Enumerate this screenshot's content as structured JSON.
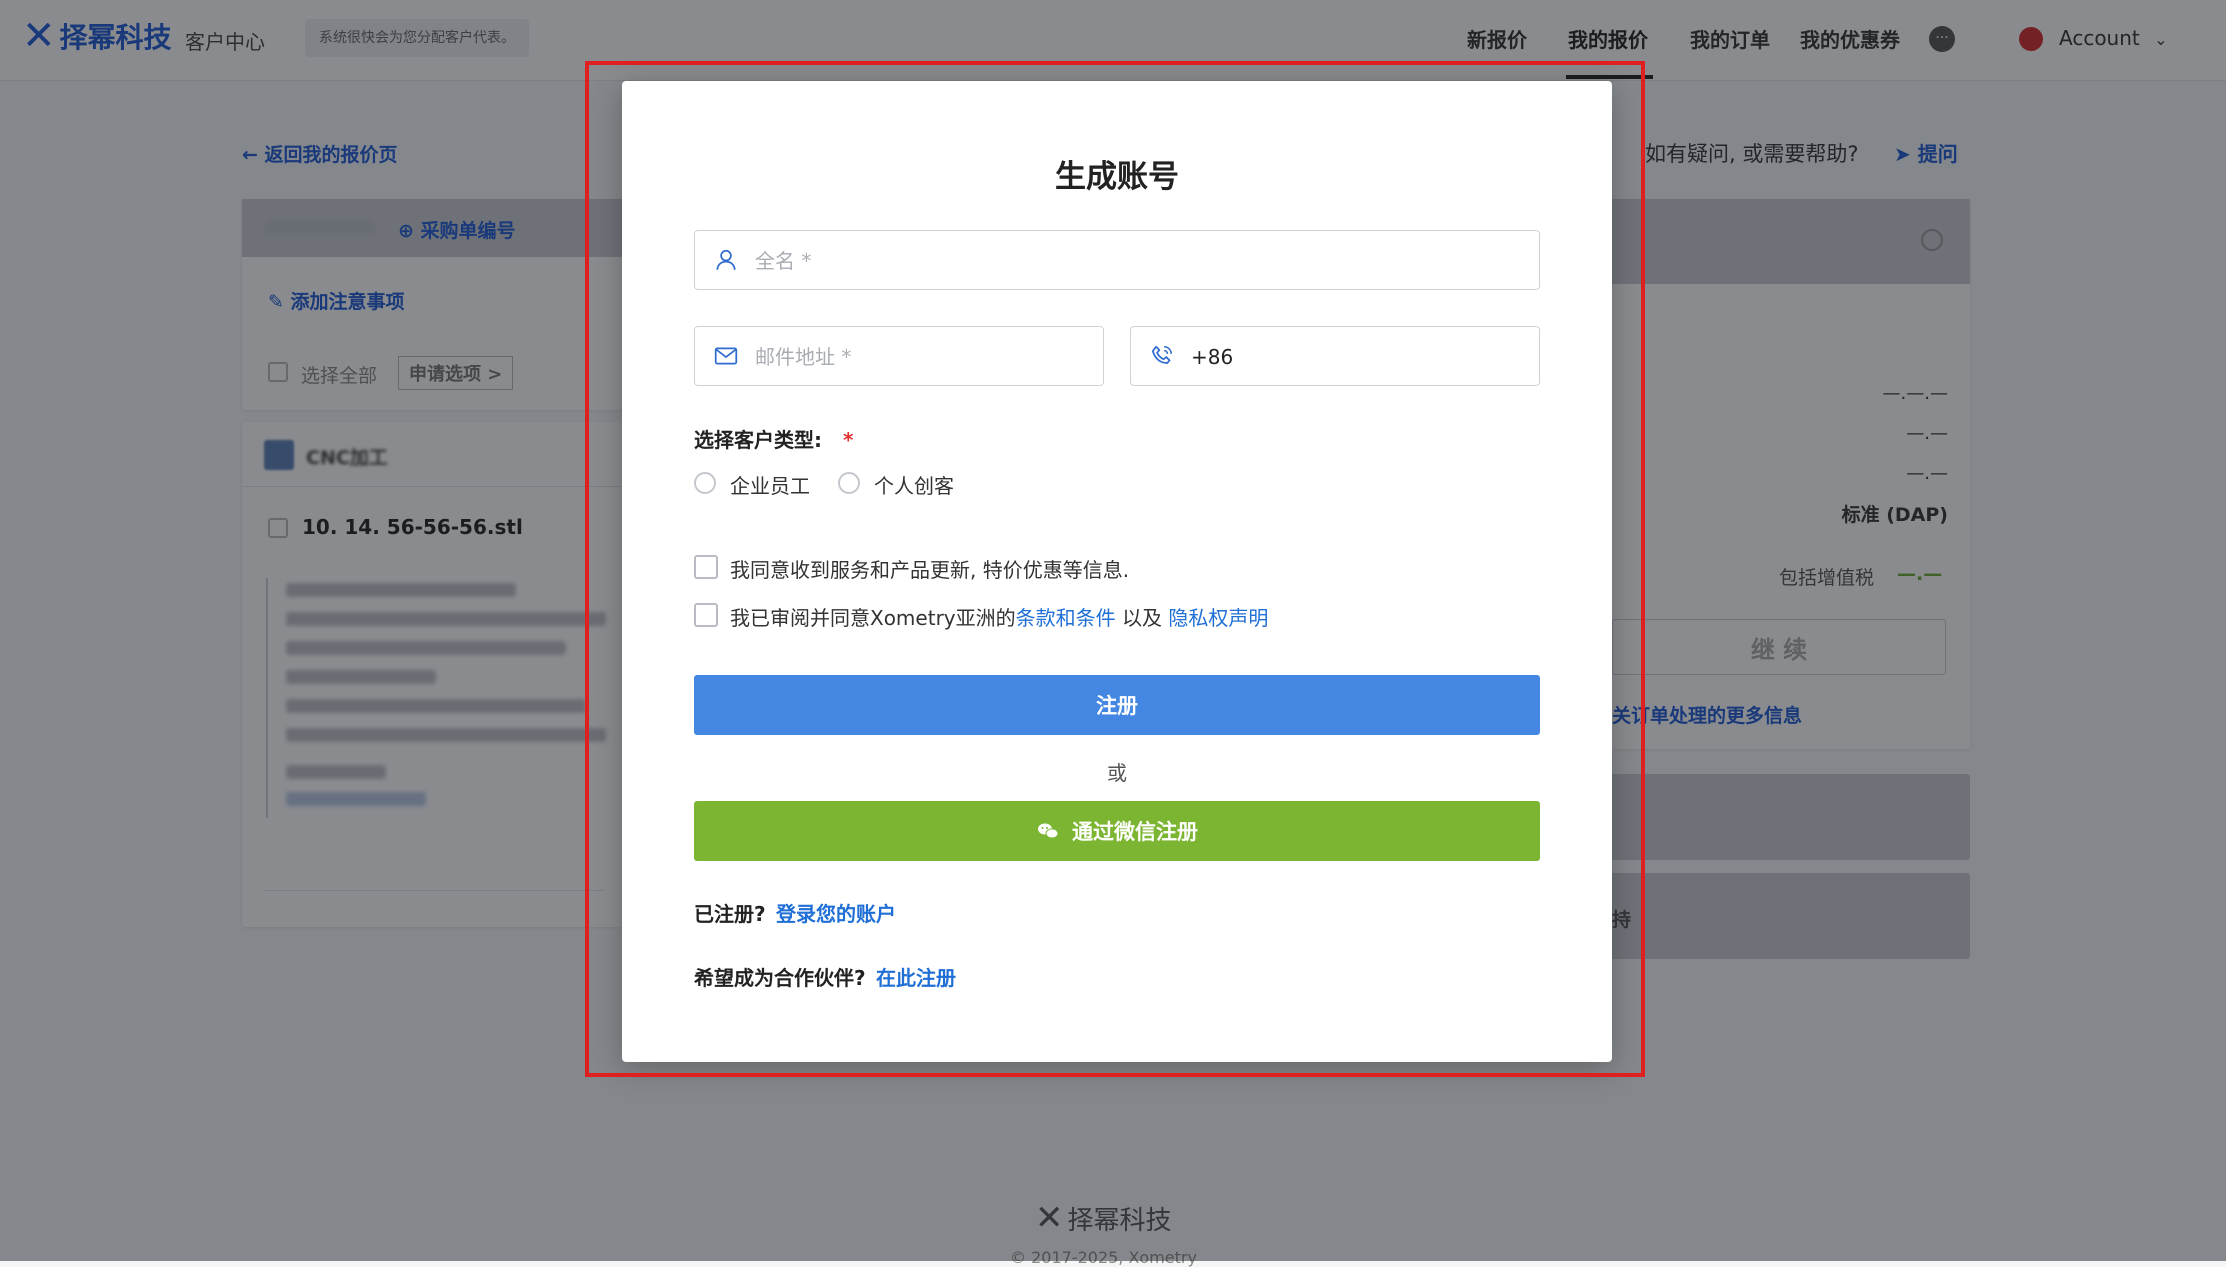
{
  "brand": {
    "name": "择幂科技",
    "portal": "客户中心"
  },
  "header": {
    "notice": "系统很快会为您分配客户代表。",
    "nav": [
      "新报价",
      "我的报价",
      "我的订单",
      "我的优惠券"
    ],
    "account_label": "Account"
  },
  "background": {
    "back_link": "返回我的报价页",
    "help_text": "如有疑问, 或需要帮助?",
    "ask_link": "提问",
    "po_link": "采购单编号",
    "add_notes": "添加注意事项",
    "select_all": "选择全部",
    "apply_options": "申请选项 >",
    "cnc_title": "CNC加工",
    "file_name": "10. 14. 56-56-56.stl",
    "summary_values": [
      "—.—.—",
      "—.—",
      "—.—"
    ],
    "shipping": "标准 (DAP)",
    "vat_label": "包括增值税",
    "vat_value": "—.—",
    "continue_btn": "继 续",
    "order_info_link": "关订单处理的更多信息",
    "support_text": "持",
    "footer_brand": "择幂科技",
    "footer_copy": "© 2017-2025, Xometry"
  },
  "modal": {
    "title": "生成账号",
    "fullname_placeholder": "全名 *",
    "email_placeholder": "邮件地址 *",
    "phone_value": "+86",
    "customer_type_label": "选择客户类型:",
    "required_mark": "*",
    "options": [
      "企业员工",
      "个人创客"
    ],
    "consent_marketing": "我同意收到服务和产品更新, 特价优惠等信息.",
    "terms_prefix": "我已审阅并同意Xometry亚洲的",
    "terms_link": "条款和条件",
    "terms_mid": " 以及 ",
    "privacy_link": "隐私权声明",
    "register_btn": "注册",
    "or_text": "或",
    "wechat_btn": "通过微信注册",
    "have_account": "已注册?",
    "login_link": "登录您的账户",
    "partner_text": "希望成为合作伙伴?",
    "partner_link": "在此注册"
  },
  "colors": {
    "primary": "#4487e2",
    "wechat": "#7cb532",
    "link": "#1f6fd6",
    "highlight": "#e02020"
  }
}
